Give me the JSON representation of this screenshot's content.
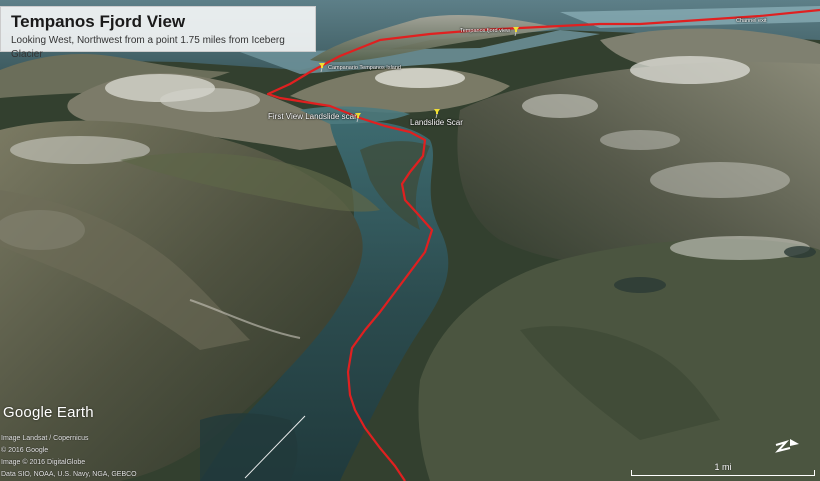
{
  "title_box": {
    "title": "Tempanos Fjord View",
    "subtitle": "Looking West, Northwest from a point 1.75 miles from Iceberg Glacier"
  },
  "placemarks": [
    {
      "label": "First View Landslide scar",
      "color": "#f2e033"
    },
    {
      "label": "Landslide Scar",
      "color": "#f2e033"
    },
    {
      "label": "Campanario Tempanos Island",
      "color": "#f2e033"
    },
    {
      "label": "Tempanos fjord view",
      "color": "#f2e033"
    },
    {
      "label": "Channel exit",
      "color": "#ffffff"
    }
  ],
  "route": {
    "color": "#e02020"
  },
  "branding": {
    "logo": "Google Earth"
  },
  "credits": {
    "line1": "Image Landsat / Copernicus",
    "line2": "© 2016 Google",
    "line3": "Image © 2016 DigitalGlobe",
    "line4": "Data SIO, NOAA, U.S. Navy, NGA, GEBCO"
  },
  "scale": {
    "label": "1 mi"
  },
  "compass": {
    "icon": "north-arrow-icon"
  }
}
